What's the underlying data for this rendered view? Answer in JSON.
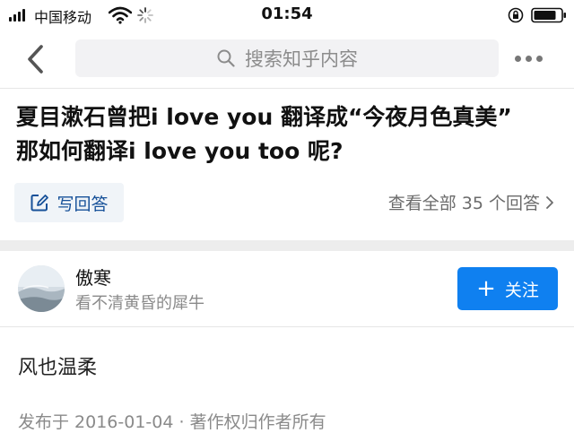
{
  "status_bar": {
    "carrier": "中国移动",
    "time": "01:54",
    "icons": [
      "signal-icon",
      "wifi-icon",
      "activity-spinner-icon",
      "orientation-lock-icon",
      "battery-icon"
    ]
  },
  "nav": {
    "search_placeholder": "搜索知乎内容",
    "icons": [
      "back-icon",
      "search-icon",
      "more-icon"
    ]
  },
  "question": {
    "title_line1": "夏目漱石曾把i love you 翻译成“今夜月色真美”",
    "title_line2": "那如何翻译i love you too 呢?",
    "write_answer_label": "写回答",
    "view_all_label": "查看全部 35 个回答"
  },
  "answer": {
    "author_name": "傲寒",
    "author_bio": "看不清黄昏的犀牛",
    "follow_plus": "+",
    "follow_label": "关注",
    "content": "风也温柔",
    "meta": "发布于 2016-01-04 · 著作权归作者所有"
  },
  "colors": {
    "accent": "#0f80f0",
    "link": "#175199",
    "muted": "#8a8a8a",
    "search_bg": "#f2f2f4"
  }
}
